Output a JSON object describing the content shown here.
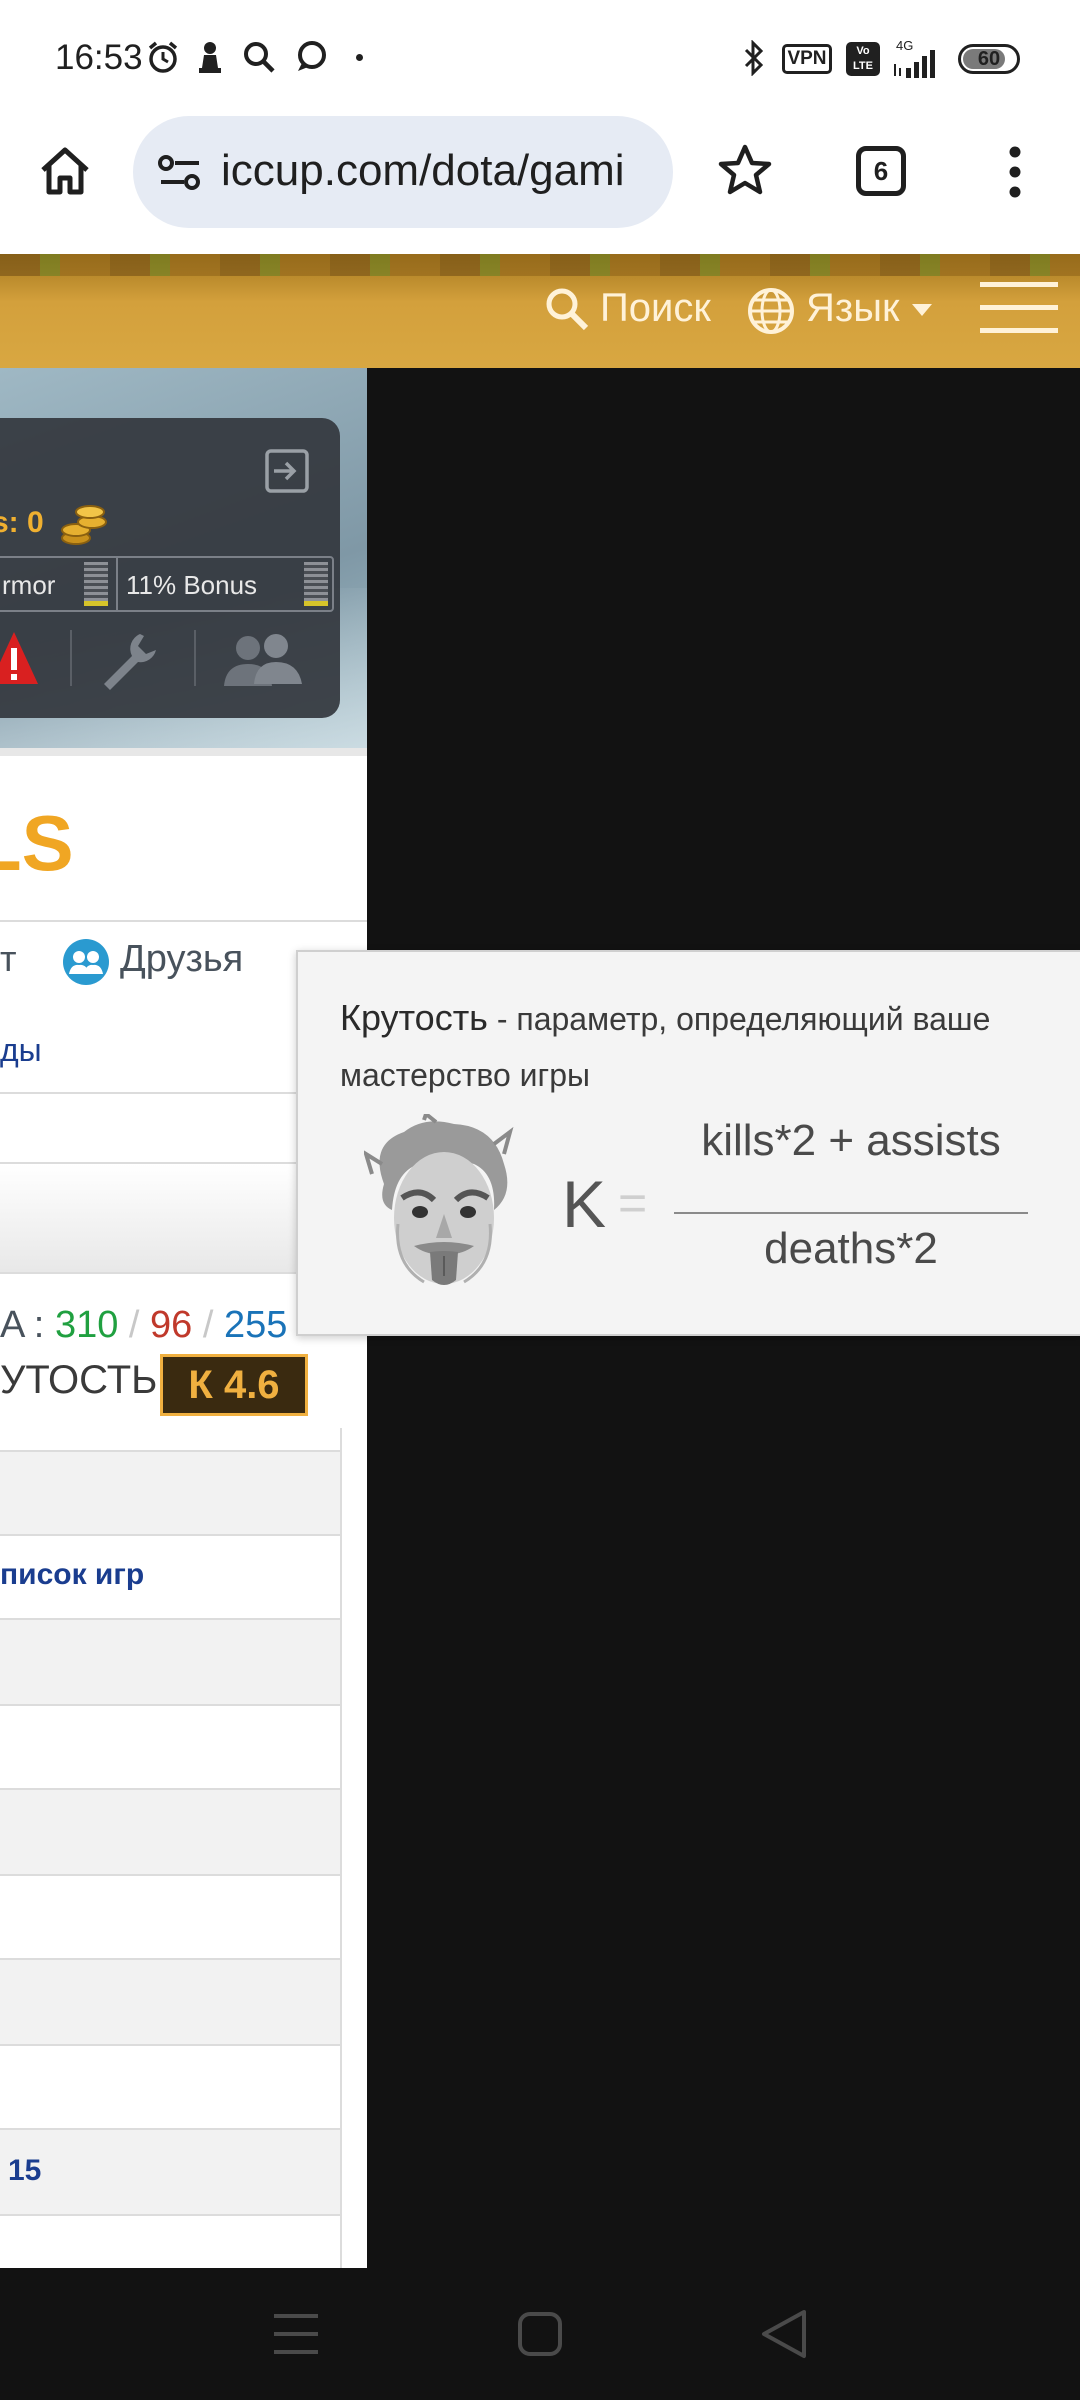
{
  "status_bar": {
    "time": "16:53",
    "vpn_label": "VPN",
    "volte_label": "Vo LTE",
    "network_label": "4G",
    "battery": "60",
    "icons": [
      "alarm-icon",
      "chess-pawn-icon",
      "search-icon",
      "chat-bubble-icon",
      "dot-icon",
      "bluetooth-icon",
      "signal-icon"
    ]
  },
  "browser": {
    "url": "iccup.com/dota/gami",
    "tab_count": "6",
    "icons": [
      "home-icon",
      "site-settings-icon",
      "bookmark-star-icon",
      "tabs-icon",
      "more-vert-icon"
    ]
  },
  "site_header": {
    "search_label": "Поиск",
    "language_label": "Язык"
  },
  "profile": {
    "coins_label": "s: 0",
    "armor_label": "rmor",
    "bonus_label": "11% Bonus",
    "title_fragment": "LS",
    "tab_partial": "т",
    "friends_label": "Друзья",
    "subnav_fragment": "ды"
  },
  "stats": {
    "kda_prefix": "A :",
    "kills": "310",
    "deaths": "96",
    "assists": "255",
    "separator": "/",
    "coolness_label": "УТОСТЬ:",
    "coolness_badge": "К 4.6",
    "games_list_link": "писок игр",
    "bottom_number": "15"
  },
  "tooltip": {
    "title": "Крутость",
    "description_dash": " - ",
    "description": "параметр, определяющий ваше мастерство игры",
    "formula_variable": "K",
    "formula_equals": "=",
    "numerator": "kills*2 + assists",
    "denominator": "deaths*2"
  },
  "colors": {
    "header_gold": "#d3a03c",
    "title_orange": "#f0a623",
    "kills_green": "#20a040",
    "deaths_red": "#c0392b",
    "assists_blue": "#1a73b8",
    "link_blue": "#1a3d8f",
    "badge_bg": "#3a2a10",
    "badge_text": "#f0b040"
  }
}
